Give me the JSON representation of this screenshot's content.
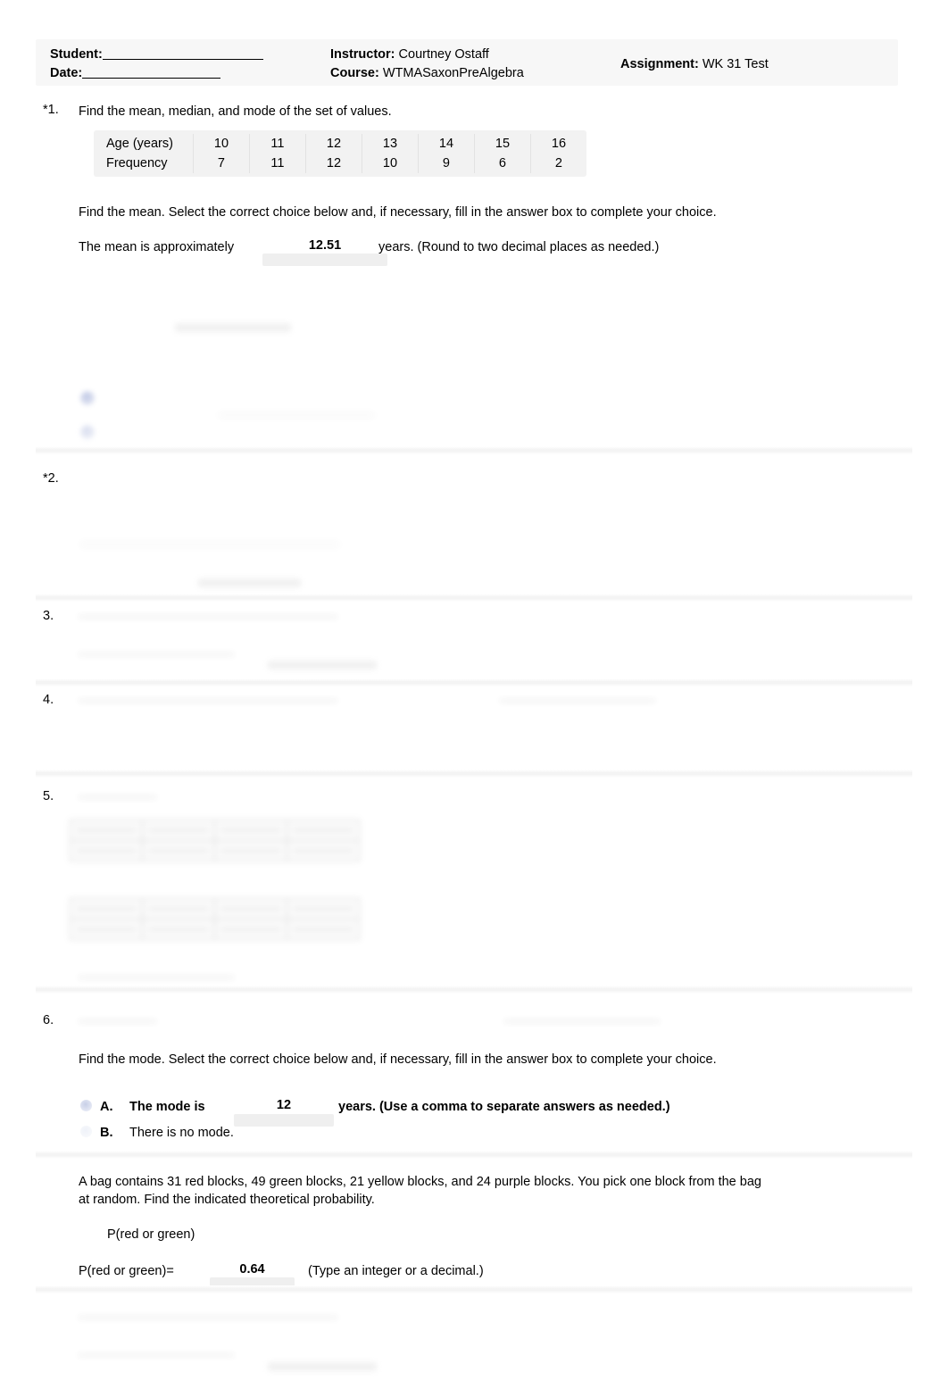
{
  "header": {
    "student_label": "Student:",
    "date_label": "Date:",
    "instructor_label": "Instructor:",
    "instructor_value": "Courtney Ostaff",
    "course_label": "Course:",
    "course_value": "WTMASaxonPreAlgebra",
    "assignment_label": "Assignment:",
    "assignment_value": "WK 31 Test"
  },
  "q1": {
    "number": "*1.",
    "prompt": "Find the mean, median, and mode of the set of values.",
    "table": {
      "row_labels": [
        "Age (years)",
        "Frequency"
      ],
      "ages": [
        "10",
        "11",
        "12",
        "13",
        "14",
        "15",
        "16"
      ],
      "frequencies": [
        "7",
        "11",
        "12",
        "10",
        "9",
        "6",
        "2"
      ]
    },
    "instruction": "Find the mean. Select the correct choice below and, if necessary, fill in the answer box to complete your choice.",
    "answer_prefix": "The mean is approximately",
    "answer_value": "12.51",
    "answer_suffix": "years. (Round to two decimal places as needed.)"
  },
  "q2": {
    "number": "*2."
  },
  "q3": {
    "number": "3."
  },
  "q4": {
    "number": "4."
  },
  "q5": {
    "number": "5."
  },
  "q6": {
    "number": "6.",
    "instruction": "Find the mode. Select the correct choice below and, if necessary, fill in the answer box to complete your choice.",
    "choices": [
      {
        "letter": "A.",
        "text_before": "The mode is",
        "value": "12",
        "text_after": "years. (Use a comma to separate answers as needed.)",
        "selected": true
      },
      {
        "letter": "B.",
        "text_before": "There is no mode.",
        "value": "",
        "text_after": "",
        "selected": false
      }
    ]
  },
  "q7": {
    "prompt_line1": "A bag contains 31 red blocks, 49 green blocks, 21 yellow blocks, and 24 purple blocks. You pick one block from the bag",
    "prompt_line2": "at random. Find the indicated theoretical probability.",
    "expression": "P(red or green)",
    "answer_label": "P(red or green)=",
    "answer_value": "0.64",
    "answer_note": "(Type an integer or a decimal.)"
  },
  "redacted": {
    "note": "illegible",
    "filler_short": "——————",
    "filler_med": "————————————",
    "filler_long": "————————————————————"
  }
}
